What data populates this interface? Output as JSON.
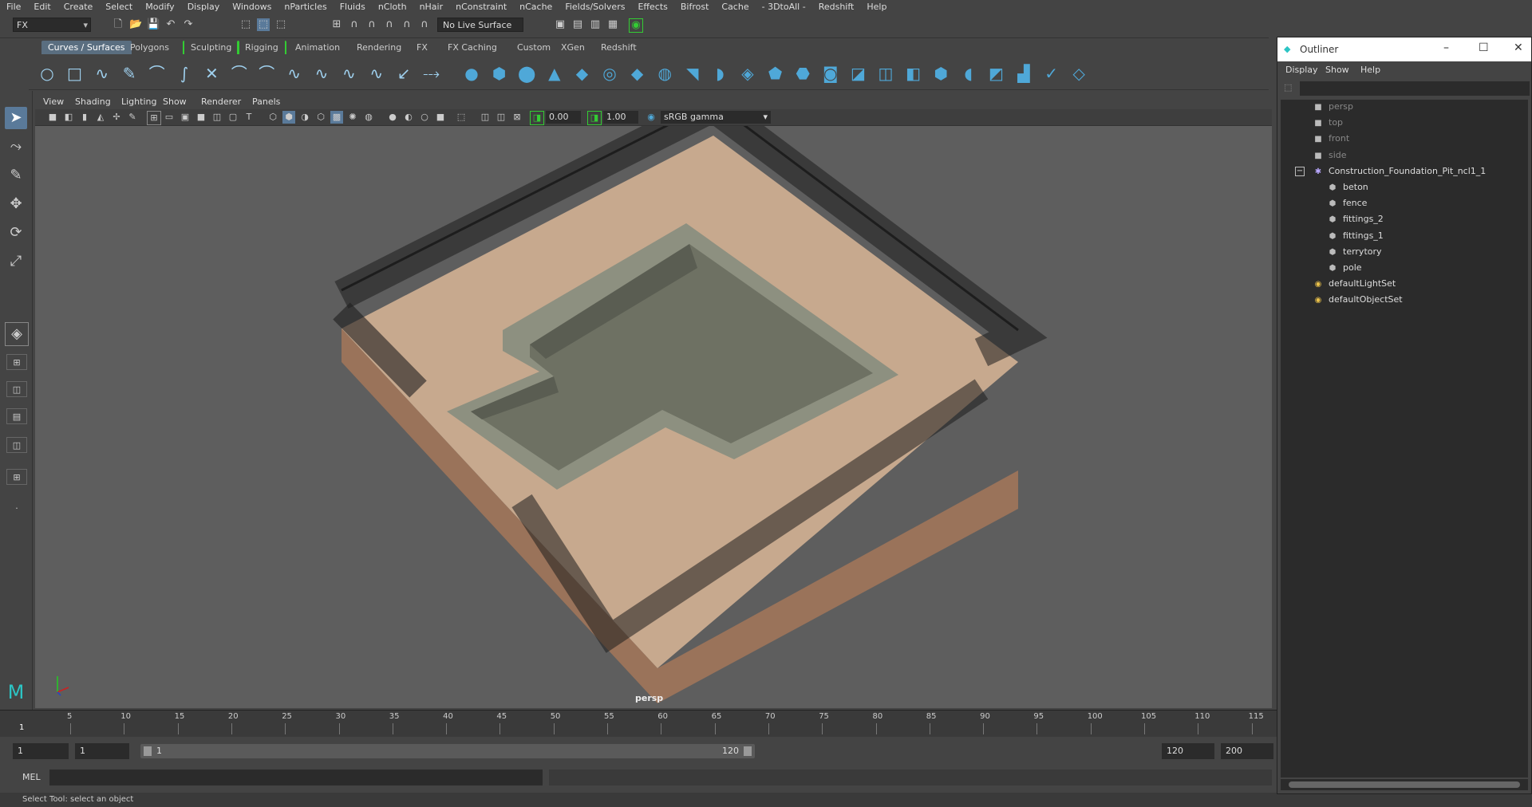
{
  "menubar": [
    "File",
    "Edit",
    "Create",
    "Select",
    "Modify",
    "Display",
    "Windows",
    "nParticles",
    "Fluids",
    "nCloth",
    "nHair",
    "nConstraint",
    "nCache",
    "Fields/Solvers",
    "Effects",
    "Bifrost",
    "Cache",
    "- 3DtoAll -",
    "Redshift",
    "Help"
  ],
  "status": {
    "mode": "FX",
    "live_surface": "No Live Surface"
  },
  "shelf_tabs": [
    "Curves / Surfaces",
    "Polygons",
    "Sculpting",
    "Rigging",
    "Animation",
    "Rendering",
    "FX",
    "FX Caching",
    "Custom",
    "XGen",
    "Redshift"
  ],
  "panel_menu": [
    "View",
    "Shading",
    "Lighting",
    "Show",
    "Renderer",
    "Panels"
  ],
  "panel_bar": {
    "exposure": "0.00",
    "gamma": "1.00",
    "color_mgmt": "sRGB gamma"
  },
  "viewport": {
    "camera": "persp"
  },
  "timeline": {
    "current_frame": "1",
    "ticks": [
      "5",
      "10",
      "15",
      "20",
      "25",
      "30",
      "35",
      "40",
      "45",
      "50",
      "55",
      "60",
      "65",
      "70",
      "75",
      "80",
      "85",
      "90",
      "95",
      "100",
      "105",
      "110",
      "115"
    ]
  },
  "range": {
    "start": "1",
    "anim_start": "1",
    "slider_start": "1",
    "slider_end": "120",
    "end": "120",
    "anim_end": "200"
  },
  "cmd": {
    "label": "MEL"
  },
  "help_line": "Select Tool: select an object",
  "outliner": {
    "title": "Outliner",
    "menu": [
      "Display",
      "Show",
      "Help"
    ],
    "items": [
      {
        "label": "persp",
        "indent": 0,
        "icon": "camera-icon",
        "dim": true
      },
      {
        "label": "top",
        "indent": 0,
        "icon": "camera-icon",
        "dim": true
      },
      {
        "label": "front",
        "indent": 0,
        "icon": "camera-icon",
        "dim": true
      },
      {
        "label": "side",
        "indent": 0,
        "icon": "camera-icon",
        "dim": true
      },
      {
        "label": "Construction_Foundation_Pit_ncl1_1",
        "indent": 0,
        "icon": "group-icon",
        "dim": false
      },
      {
        "label": "beton",
        "indent": 1,
        "icon": "mesh-icon",
        "dim": false
      },
      {
        "label": "fence",
        "indent": 1,
        "icon": "mesh-icon",
        "dim": false
      },
      {
        "label": "fittings_2",
        "indent": 1,
        "icon": "mesh-icon",
        "dim": false
      },
      {
        "label": "fittings_1",
        "indent": 1,
        "icon": "mesh-icon",
        "dim": false
      },
      {
        "label": "terrytory",
        "indent": 1,
        "icon": "mesh-icon",
        "dim": false
      },
      {
        "label": "pole",
        "indent": 1,
        "icon": "mesh-icon",
        "dim": false
      },
      {
        "label": "defaultLightSet",
        "indent": 0,
        "icon": "set-icon",
        "dim": false
      },
      {
        "label": "defaultObjectSet",
        "indent": 0,
        "icon": "set-icon",
        "dim": false
      }
    ]
  },
  "colors": {
    "accent": "#5a7a9a",
    "shelf_icon": "#4fa8d8",
    "ground": "#c7a98e",
    "soil_side": "#9a735a",
    "concrete": "#7d8070",
    "fence": "#1e1e1e",
    "viewport_bg": "#5e5e5e"
  }
}
